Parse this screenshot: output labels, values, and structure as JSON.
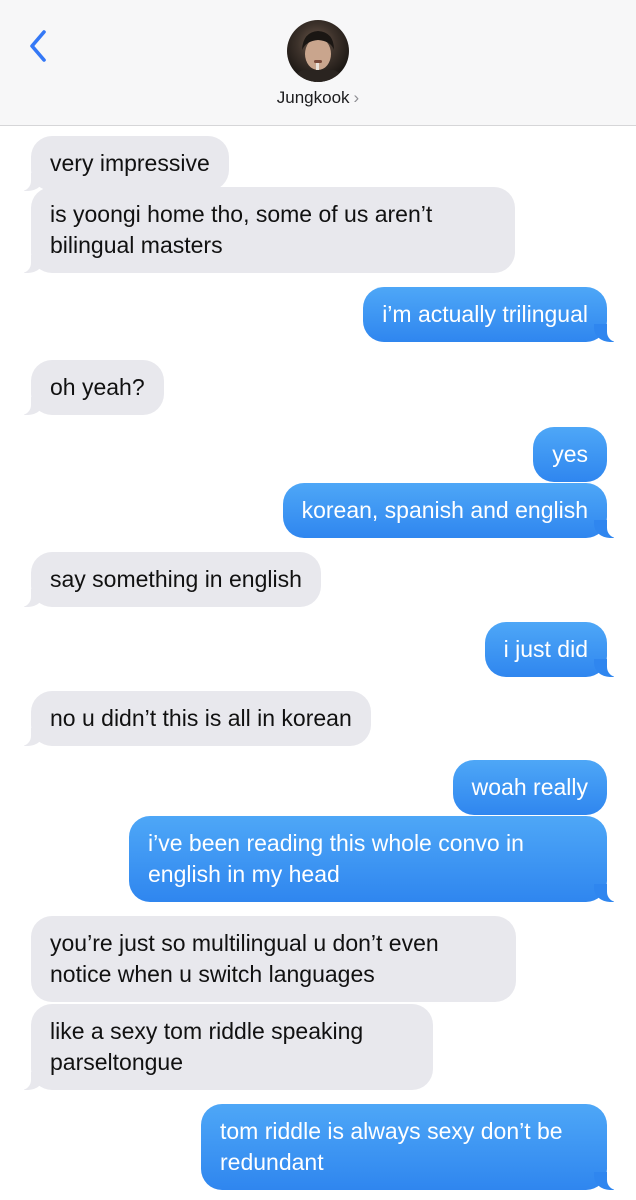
{
  "header": {
    "back_icon": "chevron-left-icon",
    "contact_name": "Jungkook",
    "chevron": "›",
    "accent_color": "#3478f6"
  },
  "colors": {
    "incoming_bubble": "#e8e8ed",
    "outgoing_bubble": "#3a8ef3",
    "header_background": "#f7f7f8"
  },
  "messages": [
    {
      "direction": "incoming",
      "text": "very impressive"
    },
    {
      "direction": "incoming",
      "text": "is yoongi home tho, some of us aren’t bilingual masters"
    },
    {
      "direction": "outgoing",
      "text": "i’m actually trilingual"
    },
    {
      "direction": "incoming",
      "text": "oh yeah?"
    },
    {
      "direction": "outgoing",
      "text": "yes"
    },
    {
      "direction": "outgoing",
      "text": "korean, spanish and english"
    },
    {
      "direction": "incoming",
      "text": "say something in english"
    },
    {
      "direction": "outgoing",
      "text": "i just did"
    },
    {
      "direction": "incoming",
      "text": "no u didn’t this is all in korean"
    },
    {
      "direction": "outgoing",
      "text": "woah really"
    },
    {
      "direction": "outgoing",
      "text": "i’ve been reading this whole convo in english in my head"
    },
    {
      "direction": "incoming",
      "text": "you’re just so multilingual u don’t even notice when u switch languages"
    },
    {
      "direction": "incoming",
      "text": "like a sexy tom riddle speaking parseltongue"
    },
    {
      "direction": "outgoing",
      "text": "tom riddle is always sexy don’t be redundant"
    }
  ]
}
